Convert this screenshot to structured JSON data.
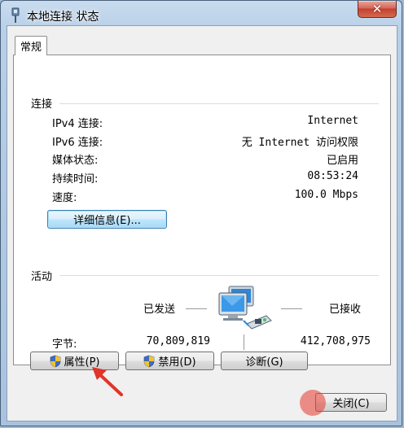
{
  "window": {
    "title": "本地连接 状态"
  },
  "tabs": [
    {
      "label": "常规"
    }
  ],
  "connection": {
    "group_label": "连接",
    "rows": [
      {
        "label": "IPv4 连接:",
        "value": "Internet"
      },
      {
        "label": "IPv6 连接:",
        "value": "无 Internet 访问权限"
      },
      {
        "label": "媒体状态:",
        "value": "已启用"
      },
      {
        "label": "持续时间:",
        "value": "08:53:24"
      },
      {
        "label": "速度:",
        "value": "100.0 Mbps"
      }
    ],
    "details_button": "详细信息(E)..."
  },
  "activity": {
    "group_label": "活动",
    "sent_label": "已发送",
    "received_label": "已接收",
    "bytes_label": "字节:",
    "bytes_sent": "70,809,819",
    "bytes_received": "412,708,975"
  },
  "buttons": {
    "properties": "属性(P)",
    "disable": "禁用(D)",
    "diagnose": "诊断(G)",
    "close": "关闭(C)"
  },
  "icons": {
    "title": "network-adapter-icon",
    "network": "network-computers-icon",
    "shield": "uac-shield-icon",
    "annotation": "red-arrow"
  },
  "colors": {
    "accent": "#3c7fb1",
    "close_button": "#c2412f",
    "annotation_arrow": "#e0352b"
  }
}
